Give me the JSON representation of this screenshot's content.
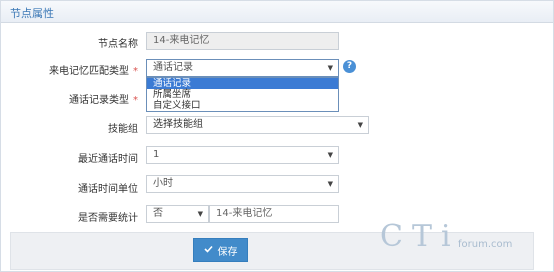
{
  "header": {
    "title": "节点属性"
  },
  "form": {
    "node_name": {
      "label": "节点名称",
      "value": "14-来电记忆"
    },
    "match_type": {
      "label": "来电记忆匹配类型",
      "required": "*",
      "value": "通话记录",
      "options": [
        "通话记录",
        "所属坐席",
        "自定义接口"
      ]
    },
    "record_type": {
      "label": "通话记录类型",
      "required": "*"
    },
    "skill_group": {
      "label": "技能组",
      "placeholder": "选择技能组"
    },
    "recent_call_time": {
      "label": "最近通话时间",
      "value": "1"
    },
    "time_unit": {
      "label": "通话时间单位",
      "value": "小时"
    },
    "need_stats": {
      "label": "是否需要统计",
      "value": "否",
      "extra_value": "14-来电记忆"
    }
  },
  "help_icon": "?",
  "footer": {
    "save_label": "保存"
  },
  "watermark": {
    "main": "CTi",
    "sub": "forum.com"
  }
}
